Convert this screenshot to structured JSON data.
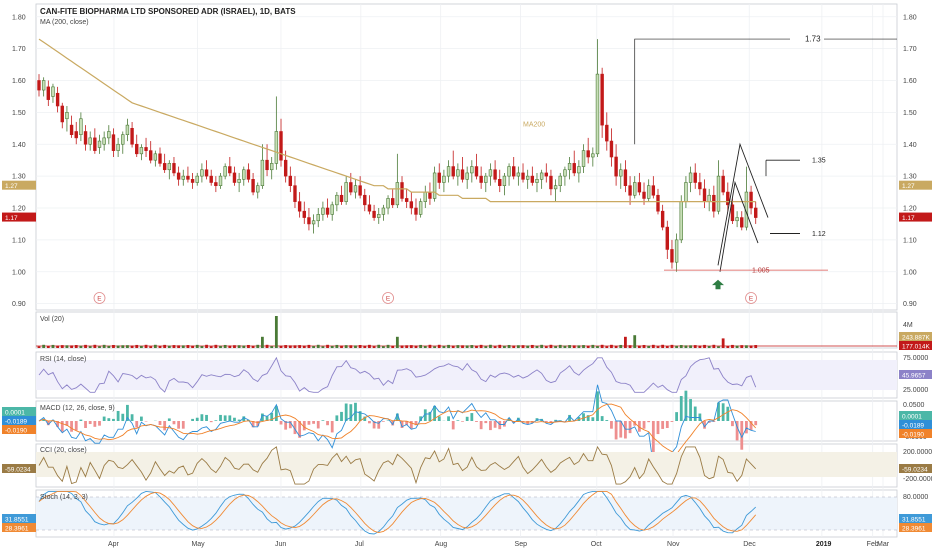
{
  "header": {
    "title": "CAN-FITE BIOPHARMA LTD SPONSORED ADR (ISRAEL), 1D, BATS",
    "indicator": "MA (200, close)"
  },
  "colors": {
    "up": "#4a7a36",
    "down": "#c21919",
    "ma": "#c9a961",
    "grid": "#eef0f3",
    "annot": "#222222",
    "support": "#d9534f",
    "rsi": "#8c82c8",
    "macd": "#2f8fd8",
    "signal": "#f0822a",
    "stochK": "#3f9ad8",
    "stochD": "#f08a34",
    "cci": "#9a7b45"
  },
  "chart_data": {
    "type": "candlestick",
    "title": "CAN-FITE BIOPHARMA LTD SPONSORED ADR (ISRAEL), 1D, BATS",
    "ylim": [
      0.88,
      1.84
    ],
    "y_ticks": [
      "1.80",
      "1.70",
      "1.60",
      "1.50",
      "1.40",
      "1.30",
      "1.20",
      "1.10",
      "1.00",
      "0.90"
    ],
    "x_ticks": [
      "Apr",
      "May",
      "Jun",
      "Jul",
      "Aug",
      "Sep",
      "Oct",
      "Nov",
      "Dec",
      "2019",
      "Feb",
      "Mar"
    ],
    "price_badges": [
      "1.27",
      "1.17"
    ],
    "ohlc": [
      [
        1.6,
        1.62,
        1.55,
        1.57
      ],
      [
        1.57,
        1.61,
        1.55,
        1.6
      ],
      [
        1.58,
        1.6,
        1.52,
        1.54
      ],
      [
        1.55,
        1.59,
        1.53,
        1.58
      ],
      [
        1.56,
        1.58,
        1.5,
        1.52
      ],
      [
        1.52,
        1.53,
        1.45,
        1.47
      ],
      [
        1.48,
        1.52,
        1.44,
        1.5
      ],
      [
        1.46,
        1.49,
        1.42,
        1.43
      ],
      [
        1.44,
        1.47,
        1.4,
        1.42
      ],
      [
        1.43,
        1.5,
        1.41,
        1.48
      ],
      [
        1.44,
        1.46,
        1.38,
        1.4
      ],
      [
        1.4,
        1.44,
        1.38,
        1.42
      ],
      [
        1.42,
        1.45,
        1.37,
        1.38
      ],
      [
        1.39,
        1.43,
        1.37,
        1.41
      ],
      [
        1.4,
        1.44,
        1.38,
        1.42
      ],
      [
        1.42,
        1.46,
        1.4,
        1.44
      ],
      [
        1.43,
        1.45,
        1.36,
        1.38
      ],
      [
        1.38,
        1.42,
        1.36,
        1.4
      ],
      [
        1.4,
        1.44,
        1.37,
        1.43
      ],
      [
        1.43,
        1.48,
        1.41,
        1.46
      ],
      [
        1.45,
        1.47,
        1.39,
        1.4
      ],
      [
        1.4,
        1.43,
        1.36,
        1.37
      ],
      [
        1.37,
        1.4,
        1.35,
        1.39
      ],
      [
        1.39,
        1.42,
        1.36,
        1.38
      ],
      [
        1.38,
        1.41,
        1.34,
        1.35
      ],
      [
        1.35,
        1.38,
        1.33,
        1.37
      ],
      [
        1.37,
        1.39,
        1.33,
        1.34
      ],
      [
        1.34,
        1.37,
        1.31,
        1.32
      ],
      [
        1.32,
        1.35,
        1.29,
        1.34
      ],
      [
        1.34,
        1.36,
        1.3,
        1.31
      ],
      [
        1.31,
        1.33,
        1.27,
        1.29
      ],
      [
        1.29,
        1.32,
        1.27,
        1.3
      ],
      [
        1.3,
        1.33,
        1.28,
        1.29
      ],
      [
        1.29,
        1.31,
        1.26,
        1.28
      ],
      [
        1.28,
        1.31,
        1.27,
        1.3
      ],
      [
        1.3,
        1.34,
        1.28,
        1.32
      ],
      [
        1.32,
        1.35,
        1.29,
        1.3
      ],
      [
        1.3,
        1.32,
        1.27,
        1.28
      ],
      [
        1.28,
        1.3,
        1.25,
        1.27
      ],
      [
        1.27,
        1.31,
        1.26,
        1.3
      ],
      [
        1.3,
        1.34,
        1.29,
        1.33
      ],
      [
        1.33,
        1.36,
        1.3,
        1.31
      ],
      [
        1.31,
        1.33,
        1.27,
        1.28
      ],
      [
        1.28,
        1.31,
        1.25,
        1.29
      ],
      [
        1.29,
        1.33,
        1.27,
        1.32
      ],
      [
        1.32,
        1.34,
        1.28,
        1.29
      ],
      [
        1.29,
        1.31,
        1.24,
        1.25
      ],
      [
        1.25,
        1.28,
        1.23,
        1.27
      ],
      [
        1.27,
        1.4,
        1.26,
        1.35
      ],
      [
        1.35,
        1.4,
        1.3,
        1.32
      ],
      [
        1.32,
        1.36,
        1.29,
        1.34
      ],
      [
        1.34,
        1.55,
        1.32,
        1.44
      ],
      [
        1.44,
        1.48,
        1.33,
        1.35
      ],
      [
        1.35,
        1.38,
        1.28,
        1.3
      ],
      [
        1.3,
        1.33,
        1.25,
        1.27
      ],
      [
        1.27,
        1.3,
        1.2,
        1.22
      ],
      [
        1.22,
        1.25,
        1.17,
        1.19
      ],
      [
        1.19,
        1.22,
        1.15,
        1.17
      ],
      [
        1.17,
        1.2,
        1.13,
        1.15
      ],
      [
        1.15,
        1.18,
        1.12,
        1.16
      ],
      [
        1.16,
        1.2,
        1.14,
        1.18
      ],
      [
        1.18,
        1.22,
        1.16,
        1.2
      ],
      [
        1.2,
        1.23,
        1.17,
        1.18
      ],
      [
        1.18,
        1.22,
        1.16,
        1.21
      ],
      [
        1.21,
        1.25,
        1.19,
        1.24
      ],
      [
        1.24,
        1.27,
        1.21,
        1.22
      ],
      [
        1.22,
        1.3,
        1.21,
        1.28
      ],
      [
        1.28,
        1.31,
        1.24,
        1.25
      ],
      [
        1.25,
        1.29,
        1.23,
        1.27
      ],
      [
        1.27,
        1.3,
        1.23,
        1.24
      ],
      [
        1.24,
        1.26,
        1.19,
        1.21
      ],
      [
        1.21,
        1.24,
        1.18,
        1.19
      ],
      [
        1.19,
        1.21,
        1.16,
        1.17
      ],
      [
        1.17,
        1.2,
        1.15,
        1.18
      ],
      [
        1.18,
        1.21,
        1.16,
        1.2
      ],
      [
        1.2,
        1.24,
        1.18,
        1.23
      ],
      [
        1.23,
        1.26,
        1.2,
        1.21
      ],
      [
        1.21,
        1.37,
        1.2,
        1.28
      ],
      [
        1.28,
        1.3,
        1.22,
        1.23
      ],
      [
        1.23,
        1.26,
        1.2,
        1.22
      ],
      [
        1.22,
        1.25,
        1.18,
        1.2
      ],
      [
        1.2,
        1.23,
        1.16,
        1.18
      ],
      [
        1.18,
        1.23,
        1.17,
        1.22
      ],
      [
        1.22,
        1.27,
        1.2,
        1.25
      ],
      [
        1.25,
        1.28,
        1.21,
        1.23
      ],
      [
        1.23,
        1.33,
        1.22,
        1.31
      ],
      [
        1.31,
        1.34,
        1.26,
        1.28
      ],
      [
        1.28,
        1.32,
        1.25,
        1.3
      ],
      [
        1.3,
        1.35,
        1.28,
        1.33
      ],
      [
        1.33,
        1.38,
        1.29,
        1.3
      ],
      [
        1.3,
        1.34,
        1.27,
        1.32
      ],
      [
        1.32,
        1.36,
        1.28,
        1.29
      ],
      [
        1.29,
        1.33,
        1.26,
        1.31
      ],
      [
        1.31,
        1.35,
        1.28,
        1.33
      ],
      [
        1.33,
        1.37,
        1.29,
        1.3
      ],
      [
        1.3,
        1.33,
        1.26,
        1.28
      ],
      [
        1.28,
        1.31,
        1.25,
        1.3
      ],
      [
        1.3,
        1.34,
        1.27,
        1.32
      ],
      [
        1.32,
        1.35,
        1.28,
        1.29
      ],
      [
        1.29,
        1.32,
        1.25,
        1.27
      ],
      [
        1.27,
        1.31,
        1.24,
        1.3
      ],
      [
        1.3,
        1.34,
        1.27,
        1.33
      ],
      [
        1.33,
        1.36,
        1.29,
        1.3
      ],
      [
        1.3,
        1.33,
        1.27,
        1.31
      ],
      [
        1.31,
        1.34,
        1.28,
        1.29
      ],
      [
        1.29,
        1.32,
        1.26,
        1.3
      ],
      [
        1.3,
        1.33,
        1.27,
        1.28
      ],
      [
        1.28,
        1.31,
        1.25,
        1.29
      ],
      [
        1.29,
        1.32,
        1.26,
        1.31
      ],
      [
        1.31,
        1.34,
        1.28,
        1.3
      ],
      [
        1.3,
        1.32,
        1.24,
        1.26
      ],
      [
        1.26,
        1.29,
        1.22,
        1.27
      ],
      [
        1.27,
        1.31,
        1.25,
        1.3
      ],
      [
        1.3,
        1.33,
        1.27,
        1.32
      ],
      [
        1.32,
        1.36,
        1.29,
        1.34
      ],
      [
        1.34,
        1.38,
        1.3,
        1.31
      ],
      [
        1.31,
        1.35,
        1.28,
        1.33
      ],
      [
        1.33,
        1.4,
        1.31,
        1.38
      ],
      [
        1.38,
        1.42,
        1.34,
        1.36
      ],
      [
        1.36,
        1.39,
        1.33,
        1.37
      ],
      [
        1.37,
        1.73,
        1.36,
        1.62
      ],
      [
        1.62,
        1.64,
        1.42,
        1.46
      ],
      [
        1.46,
        1.5,
        1.38,
        1.41
      ],
      [
        1.41,
        1.45,
        1.33,
        1.36
      ],
      [
        1.36,
        1.4,
        1.27,
        1.3
      ],
      [
        1.3,
        1.34,
        1.26,
        1.32
      ],
      [
        1.32,
        1.35,
        1.25,
        1.27
      ],
      [
        1.27,
        1.3,
        1.21,
        1.24
      ],
      [
        1.24,
        1.3,
        1.23,
        1.28
      ],
      [
        1.28,
        1.31,
        1.24,
        1.25
      ],
      [
        1.25,
        1.28,
        1.21,
        1.23
      ],
      [
        1.23,
        1.29,
        1.22,
        1.27
      ],
      [
        1.27,
        1.3,
        1.23,
        1.24
      ],
      [
        1.24,
        1.26,
        1.18,
        1.19
      ],
      [
        1.19,
        1.21,
        1.13,
        1.14
      ],
      [
        1.14,
        1.16,
        1.04,
        1.07
      ],
      [
        1.07,
        1.1,
        1.01,
        1.03
      ],
      [
        1.03,
        1.12,
        1.0,
        1.1
      ],
      [
        1.1,
        1.24,
        1.09,
        1.22
      ],
      [
        1.22,
        1.3,
        1.2,
        1.28
      ],
      [
        1.28,
        1.33,
        1.25,
        1.31
      ],
      [
        1.31,
        1.34,
        1.26,
        1.28
      ],
      [
        1.28,
        1.31,
        1.24,
        1.26
      ],
      [
        1.26,
        1.29,
        1.2,
        1.22
      ],
      [
        1.22,
        1.26,
        1.19,
        1.24
      ],
      [
        1.24,
        1.27,
        1.17,
        1.19
      ],
      [
        1.19,
        1.35,
        1.18,
        1.3
      ],
      [
        1.3,
        1.32,
        1.24,
        1.25
      ],
      [
        1.25,
        1.28,
        1.19,
        1.21
      ],
      [
        1.21,
        1.23,
        1.15,
        1.16
      ],
      [
        1.16,
        1.19,
        1.14,
        1.17
      ],
      [
        1.17,
        1.19,
        1.13,
        1.14
      ],
      [
        1.14,
        1.33,
        1.13,
        1.25
      ],
      [
        1.25,
        1.27,
        1.18,
        1.2
      ],
      [
        1.2,
        1.22,
        1.15,
        1.17
      ]
    ],
    "ma200": [
      1.73,
      1.72,
      1.71,
      1.7,
      1.69,
      1.68,
      1.67,
      1.66,
      1.65,
      1.64,
      1.63,
      1.62,
      1.61,
      1.6,
      1.59,
      1.58,
      1.57,
      1.56,
      1.55,
      1.54,
      1.53,
      1.525,
      1.52,
      1.515,
      1.51,
      1.505,
      1.5,
      1.495,
      1.49,
      1.485,
      1.48,
      1.475,
      1.47,
      1.465,
      1.46,
      1.455,
      1.45,
      1.445,
      1.44,
      1.435,
      1.43,
      1.425,
      1.42,
      1.415,
      1.41,
      1.405,
      1.4,
      1.395,
      1.39,
      1.385,
      1.38,
      1.375,
      1.37,
      1.365,
      1.36,
      1.355,
      1.35,
      1.345,
      1.34,
      1.335,
      1.33,
      1.325,
      1.32,
      1.315,
      1.31,
      1.305,
      1.3,
      1.295,
      1.29,
      1.285,
      1.28,
      1.275,
      1.27,
      1.27,
      1.27,
      1.26,
      1.26,
      1.26,
      1.26,
      1.26,
      1.25,
      1.25,
      1.25,
      1.25,
      1.25,
      1.25,
      1.24,
      1.24,
      1.24,
      1.24,
      1.24,
      1.23,
      1.23,
      1.23,
      1.23,
      1.23,
      1.23,
      1.22,
      1.22,
      1.22,
      1.22,
      1.22,
      1.22,
      1.22,
      1.22,
      1.22,
      1.22,
      1.22,
      1.22,
      1.22,
      1.22,
      1.22,
      1.22,
      1.22,
      1.22,
      1.22,
      1.22,
      1.22,
      1.22,
      1.22,
      1.22,
      1.22,
      1.22,
      1.22,
      1.22,
      1.22,
      1.22,
      1.22,
      1.22,
      1.22,
      1.22,
      1.22,
      1.22,
      1.22,
      1.22,
      1.22,
      1.22,
      1.22,
      1.22,
      1.22,
      1.22,
      1.22,
      1.22,
      1.22,
      1.22,
      1.22,
      1.22,
      1.22,
      1.22,
      1.22,
      1.22,
      1.22,
      1.22,
      1.22,
      1.22,
      1.22,
      1.22,
      1.22,
      1.22,
      1.22,
      1.22,
      1.22,
      1.22,
      1.22,
      1.22,
      1.22,
      1.22
    ],
    "annotations": {
      "ma_label": "MA200",
      "high_label": "1.73",
      "resistance_label": "1.35",
      "mid_label": "1.12",
      "support_label": "1.005",
      "earnings_label": "E"
    },
    "panels": [
      {
        "name": "vol",
        "label": "Vol (20)",
        "badges": [
          "243.887K",
          "177.014K"
        ],
        "ticks": [
          "4M"
        ]
      },
      {
        "name": "rsi",
        "label": "RSI (14, close)",
        "badges": [
          "45.9657"
        ],
        "ticks": [
          "75.0000",
          "25.0000"
        ]
      },
      {
        "name": "macd",
        "label": "MACD (12, 26, close, 9)",
        "badges": [
          "0.0001",
          "-0.0189",
          "-0.0190"
        ],
        "ticks": [
          "0.0500",
          "0.0000",
          "-0.0500"
        ]
      },
      {
        "name": "cci",
        "label": "CCI (20, close)",
        "badges": [
          "-59.0234"
        ],
        "ticks": [
          "200.0000",
          "-200.0000"
        ]
      },
      {
        "name": "stoch",
        "label": "Stoch (14, 3, 3)",
        "badges": [
          "31.8551",
          "28.3961"
        ],
        "ticks": [
          "80.0000",
          "20.0000"
        ]
      }
    ]
  }
}
